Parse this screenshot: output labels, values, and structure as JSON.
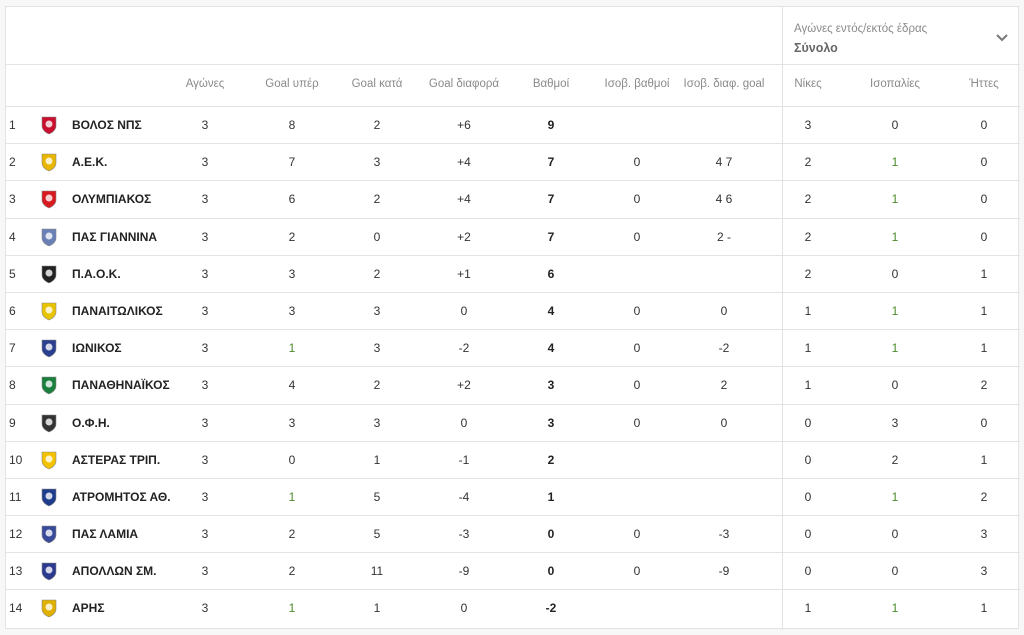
{
  "filter": {
    "label": "Αγώνες εντός/εκτός έδρας",
    "value": "Σύνολο",
    "icon": "chevron-down-icon"
  },
  "headers": {
    "played": "Αγώνες",
    "goals_for": "Goal υπέρ",
    "goals_against": "Goal κατά",
    "goal_diff": "Goal διαφορά",
    "points": "Βαθμοί",
    "tie_points": "Ισοβ. βαθμοί",
    "tie_goal_diff": "Ισοβ. διαφ. goal",
    "wins": "Νίκες",
    "draws": "Ισοπαλίες",
    "losses": "Ήττες"
  },
  "rows": [
    {
      "pos": "1",
      "team": "ΒΟΛΟΣ ΝΠΣ",
      "played": "3",
      "gf": "8",
      "ga": "2",
      "gd": "+6",
      "pts": "9",
      "isop": "",
      "isog": "",
      "w": "3",
      "d": "0",
      "l": "0",
      "logo": "volos-crest",
      "color": "#c8102e"
    },
    {
      "pos": "2",
      "team": "Α.Ε.Κ.",
      "played": "3",
      "gf": "7",
      "ga": "3",
      "gd": "+4",
      "pts": "7",
      "isop": "0",
      "isog": "4 7",
      "w": "2",
      "d": "1",
      "l": "0",
      "logo": "aek-crest",
      "color": "#e8b600"
    },
    {
      "pos": "3",
      "team": "ΟΛΥΜΠΙΑΚΟΣ",
      "played": "3",
      "gf": "6",
      "ga": "2",
      "gd": "+4",
      "pts": "7",
      "isop": "0",
      "isog": "4 6",
      "w": "2",
      "d": "1",
      "l": "0",
      "logo": "olympiakos-crest",
      "color": "#d71920"
    },
    {
      "pos": "4",
      "team": "ΠΑΣ ΓΙΑΝΝΙΝΑ",
      "played": "3",
      "gf": "2",
      "ga": "0",
      "gd": "+2",
      "pts": "7",
      "isop": "0",
      "isog": "2 -",
      "w": "2",
      "d": "1",
      "l": "0",
      "logo": "pas-giannina-crest",
      "color": "#6a7fb5"
    },
    {
      "pos": "5",
      "team": "Π.Α.Ο.Κ.",
      "played": "3",
      "gf": "3",
      "ga": "2",
      "gd": "+1",
      "pts": "6",
      "isop": "",
      "isog": "",
      "w": "2",
      "d": "0",
      "l": "1",
      "logo": "paok-crest",
      "color": "#222222"
    },
    {
      "pos": "6",
      "team": "ΠΑΝΑΙΤΩΛΙΚΟΣ",
      "played": "3",
      "gf": "3",
      "ga": "3",
      "gd": "0",
      "pts": "4",
      "isop": "0",
      "isog": "0",
      "w": "1",
      "d": "1",
      "l": "1",
      "logo": "panaitolikos-crest",
      "color": "#e8c400"
    },
    {
      "pos": "7",
      "team": "ΙΩΝΙΚΟΣ",
      "played": "3",
      "gf": "1",
      "ga": "3",
      "gd": "-2",
      "pts": "4",
      "isop": "0",
      "isog": "-2",
      "w": "1",
      "d": "1",
      "l": "1",
      "logo": "ionikos-crest",
      "color": "#2a3f8f"
    },
    {
      "pos": "8",
      "team": "ΠΑΝΑΘΗΝΑΪΚΟΣ",
      "played": "3",
      "gf": "4",
      "ga": "2",
      "gd": "+2",
      "pts": "3",
      "isop": "0",
      "isog": "2",
      "w": "1",
      "d": "0",
      "l": "2",
      "logo": "panathinaikos-crest",
      "color": "#1a7f3c"
    },
    {
      "pos": "9",
      "team": "Ο.Φ.Η.",
      "played": "3",
      "gf": "3",
      "ga": "3",
      "gd": "0",
      "pts": "3",
      "isop": "0",
      "isog": "0",
      "w": "0",
      "d": "3",
      "l": "0",
      "logo": "ofi-crest",
      "color": "#333333"
    },
    {
      "pos": "10",
      "team": "ΑΣΤΕΡΑΣ ΤΡΙΠ.",
      "played": "3",
      "gf": "0",
      "ga": "1",
      "gd": "-1",
      "pts": "2",
      "isop": "",
      "isog": "",
      "w": "0",
      "d": "2",
      "l": "1",
      "logo": "asteras-crest",
      "color": "#f2c200"
    },
    {
      "pos": "11",
      "team": "ΑΤΡΟΜΗΤΟΣ ΑΘ.",
      "played": "3",
      "gf": "1",
      "ga": "5",
      "gd": "-4",
      "pts": "1",
      "isop": "",
      "isog": "",
      "w": "0",
      "d": "1",
      "l": "2",
      "logo": "atromitos-crest",
      "color": "#1e3c8c"
    },
    {
      "pos": "12",
      "team": "ΠΑΣ ΛΑΜΙΑ",
      "played": "3",
      "gf": "2",
      "ga": "5",
      "gd": "-3",
      "pts": "0",
      "isop": "0",
      "isog": "-3",
      "w": "0",
      "d": "0",
      "l": "3",
      "logo": "lamia-crest",
      "color": "#3a4a9a"
    },
    {
      "pos": "13",
      "team": "ΑΠΟΛΛΩΝ ΣΜ.",
      "played": "3",
      "gf": "2",
      "ga": "11",
      "gd": "-9",
      "pts": "0",
      "isop": "0",
      "isog": "-9",
      "w": "0",
      "d": "0",
      "l": "3",
      "logo": "apollon-crest",
      "color": "#2b3a8f"
    },
    {
      "pos": "14",
      "team": "ΑΡΗΣ",
      "played": "3",
      "gf": "1",
      "ga": "1",
      "gd": "0",
      "pts": "-2",
      "isop": "",
      "isog": "",
      "w": "1",
      "d": "1",
      "l": "1",
      "logo": "aris-crest",
      "color": "#e0b000"
    }
  ]
}
